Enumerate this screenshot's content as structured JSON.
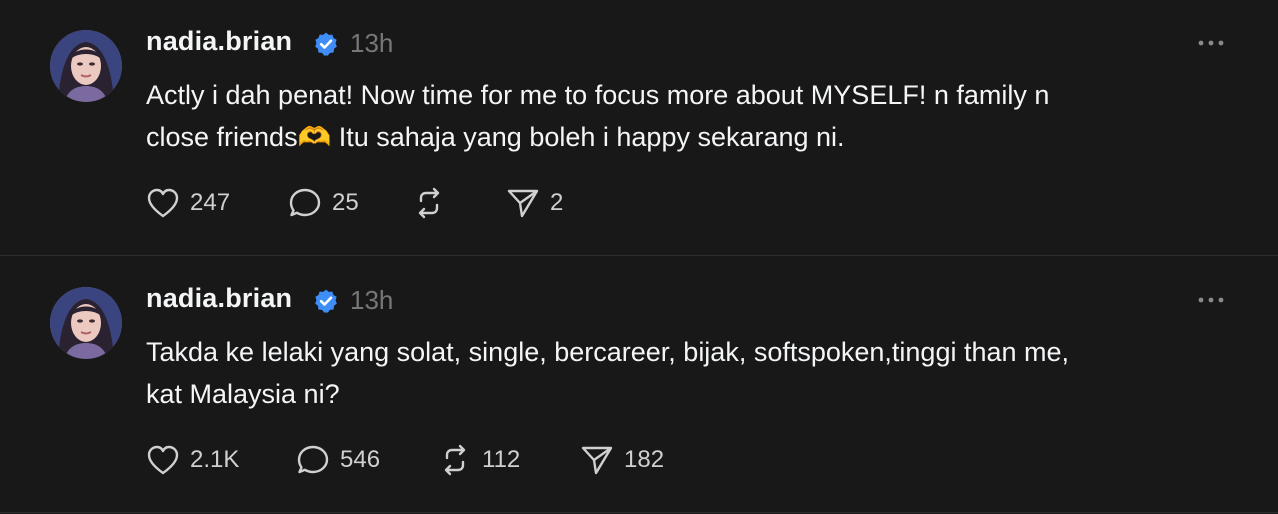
{
  "colors": {
    "background": "#181818",
    "text": "#f3f5f7",
    "muted": "#777777",
    "verified": "#3f8ef7",
    "divider": "#2e2e2e"
  },
  "posts": [
    {
      "username": "nadia.brian",
      "time": "13h",
      "text": "Actly i dah penat! Now time for me to focus more about MYSELF! n family n\nclose friends🫶 Itu sahaja yang boleh i happy sekarang ni.",
      "likes": "247",
      "replies": "25",
      "reposts": "",
      "shares": "2"
    },
    {
      "username": "nadia.brian",
      "time": "13h",
      "text": "Takda ke lelaki yang solat, single, bercareer, bijak, softspoken,tinggi than me,\nkat Malaysia ni?",
      "likes": "2.1K",
      "replies": "546",
      "reposts": "112",
      "shares": "182"
    }
  ],
  "icons": {
    "verified": "verified-badge-icon",
    "more": "more-options-icon",
    "like": "heart-icon",
    "reply": "comment-icon",
    "repost": "repost-icon",
    "share": "share-icon"
  }
}
